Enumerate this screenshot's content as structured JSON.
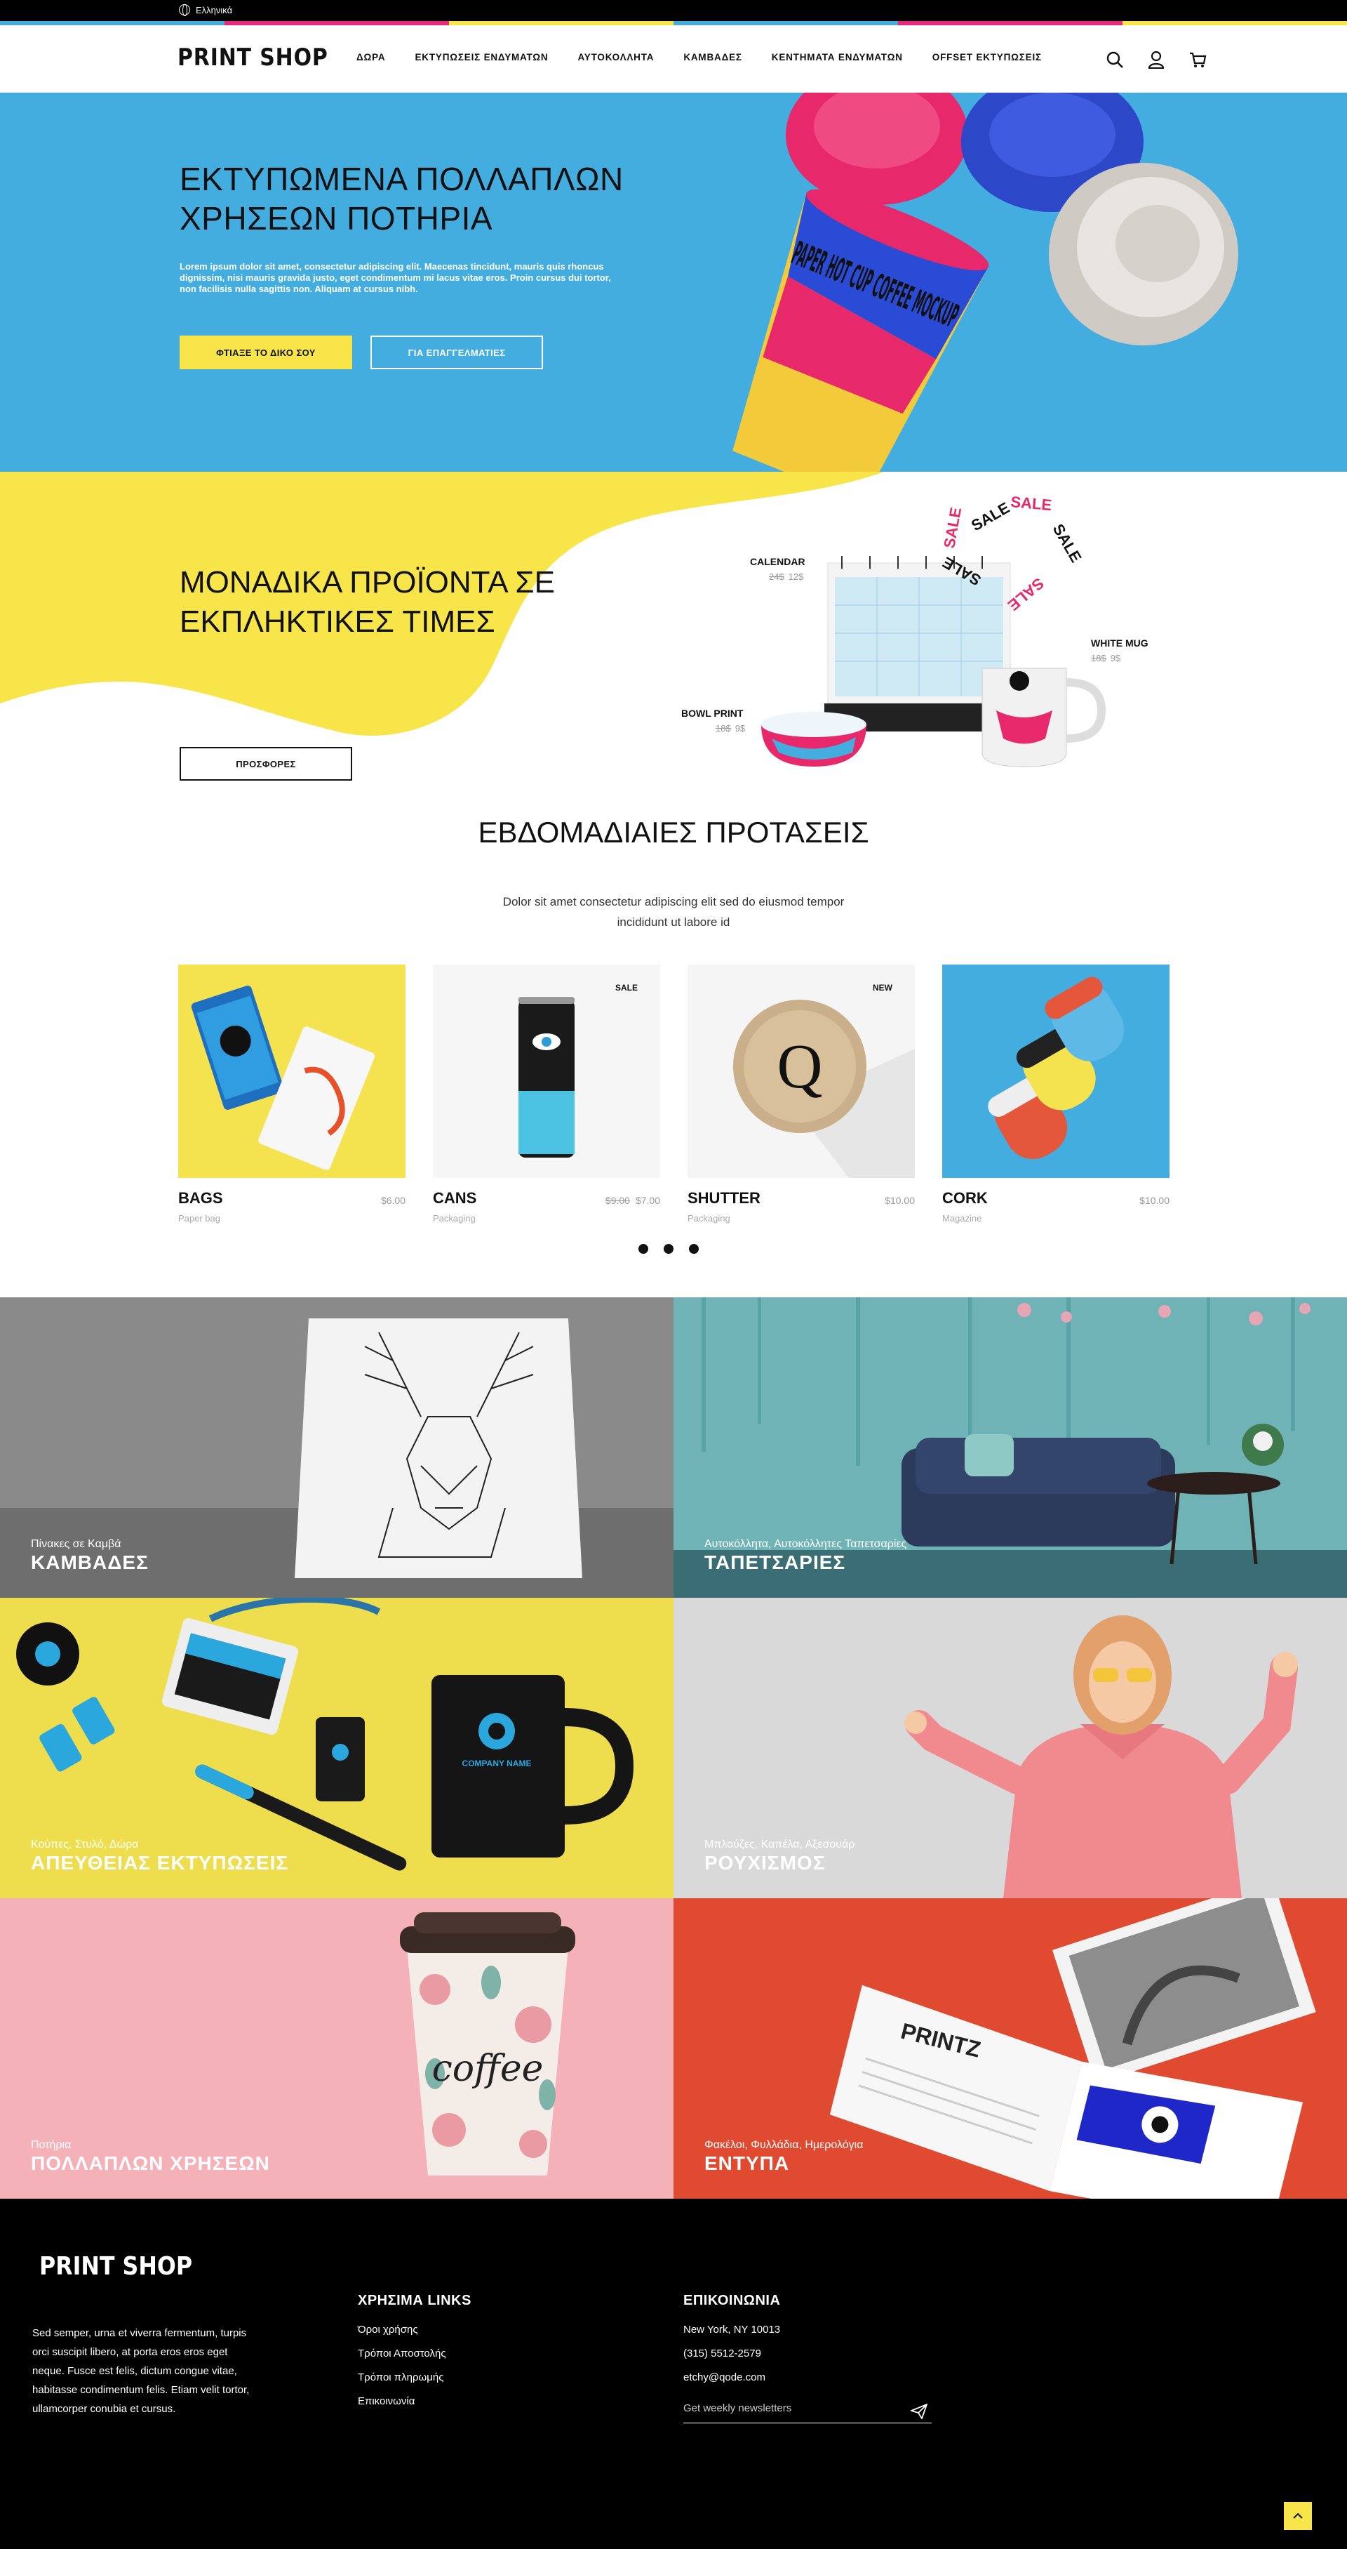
{
  "topbar": {
    "language": "Ελληνικά"
  },
  "colors": {
    "cyan": "#44ade0",
    "magenta": "#e7287a",
    "yellow": "#f7e54a",
    "black": "#000000"
  },
  "header": {
    "logo": "PRINT SHOP",
    "nav": [
      "ΔΩΡΑ",
      "ΕΚΤΥΠΩΣΕΙΣ ΕΝΔΥΜΑΤΩΝ",
      "ΑΥΤΟΚΟΛΛΗΤΑ",
      "ΚΑΜΒΑΔΕΣ",
      "ΚΕΝΤΗΜΑΤΑ ΕΝΔΥΜΑΤΩΝ",
      "OFFSET ΕΚΤΥΠΩΣΕΙΣ"
    ],
    "icons": [
      "search-icon",
      "user-icon",
      "cart-icon"
    ]
  },
  "hero": {
    "title": "ΕΚΤΥΠΩΜΕΝΑ ΠΟΛΛΑΠΛΩΝ ΧΡΗΣΕΩΝ ΠΟΤΗΡΙΑ",
    "text": "Lorem ipsum dolor sit amet, consectetur adipiscing elit. Maecenas tincidunt, mauris quis rhoncus dignissim, nisi mauris gravida justo, eget condimentum mi lacus vitae eros. Proin cursus dui tortor, non facilisis nulla sagittis non. Aliquam at cursus nibh.",
    "primary_button": "ΦΤΙΑΞΕ ΤΟ ΔΙΚΟ ΣΟΥ",
    "secondary_button": "ΓΙΑ ΕΠΑΓΓΕΛΜΑΤΙΕΣ",
    "cup_text": "PAPER HOT CUP COFFEE MOCKUP"
  },
  "promo": {
    "title": "ΜΟΝΑΔΙΚΑ ΠΡΟΪΟΝΤΑ ΣΕ ΕΚΠΛΗΚΤΙΚΕΣ ΤΙΜΕΣ",
    "button": "ΠΡΟΣΦΟΡΕΣ",
    "sale_word": "SALE",
    "items": [
      {
        "label": "CALENDAR",
        "old_price": "24$",
        "price": "12$"
      },
      {
        "label": "WHITE MUG",
        "old_price": "18$",
        "price": "9$"
      },
      {
        "label": "BOWL PRINT",
        "old_price": "18$",
        "price": "9$"
      }
    ]
  },
  "weekly": {
    "title": "ΕΒΔΟΜΑΔΙΑΙΕΣ ΠΡΟΤΑΣΕΙΣ",
    "subtitle": "Dolor sit amet consectetur adipiscing elit sed do eiusmod tempor incididunt ut labore id",
    "products": [
      {
        "name": "BAGS",
        "category": "Paper bag",
        "old_price": "",
        "price": "$6.00",
        "badge": ""
      },
      {
        "name": "CANS",
        "category": "Packaging",
        "old_price": "$9.00",
        "price": "$7.00",
        "badge": "SALE"
      },
      {
        "name": "SHUTTER",
        "category": "Packaging",
        "old_price": "",
        "price": "$10.00",
        "badge": "NEW"
      },
      {
        "name": "CORK",
        "category": "Magazine",
        "old_price": "",
        "price": "$10.00",
        "badge": ""
      }
    ]
  },
  "categories": [
    {
      "subtitle": "Πίνακες σε Καμβά",
      "title": "ΚΑΜΒΑΔΕΣ"
    },
    {
      "subtitle": "Αυτοκόλλητα, Αυτοκόλλητες Ταπετσαρίες",
      "title": "ΤΑΠΕΤΣΑΡΙΕΣ"
    },
    {
      "subtitle": "Κούπες, Στυλό, Δώρα",
      "title": "ΑΠΕΥΘΕΙΑΣ ΕΚΤΥΠΩΣΕΙΣ",
      "mug_text": "COMPANY NAME"
    },
    {
      "subtitle": "Μπλούζες, Καπέλα, Αξεσουάρ",
      "title": "ΡΟΥΧΙΣΜΟΣ"
    },
    {
      "subtitle": "Ποτήρια",
      "title": "ΠΟΛΛΑΠΛΩΝ ΧΡΗΣΕΩΝ",
      "cup_text": "coffee"
    },
    {
      "subtitle": "Φακέλοι, Φυλλάδια, Ημερολόγια",
      "title": "ΕΝΤΥΠΑ",
      "mag_text": "PRINTZ"
    }
  ],
  "footer": {
    "logo": "PRINT SHOP",
    "about": "Sed semper, urna et viverra fermentum, turpis orci suscipit libero, at porta eros eros eget neque. Fusce est felis, dictum congue vitae, habitasse condimentum felis. Etiam velit tortor, ullamcorper conubia et cursus.",
    "links_title": "ΧΡΗΣΙΜΑ LINKS",
    "links": [
      "Όροι χρήσης",
      "Τρόποι Αποστολής",
      "Τρόποι πληρωμής",
      "Επικοινωνία"
    ],
    "contact_title": "ΕΠΙΚΟΙΝΩΝΙΑ",
    "contact": [
      "New York, NY 10013",
      "(315) 5512-2579",
      "etchy@qode.com"
    ],
    "newsletter_placeholder": "Get weekly newsletters"
  }
}
